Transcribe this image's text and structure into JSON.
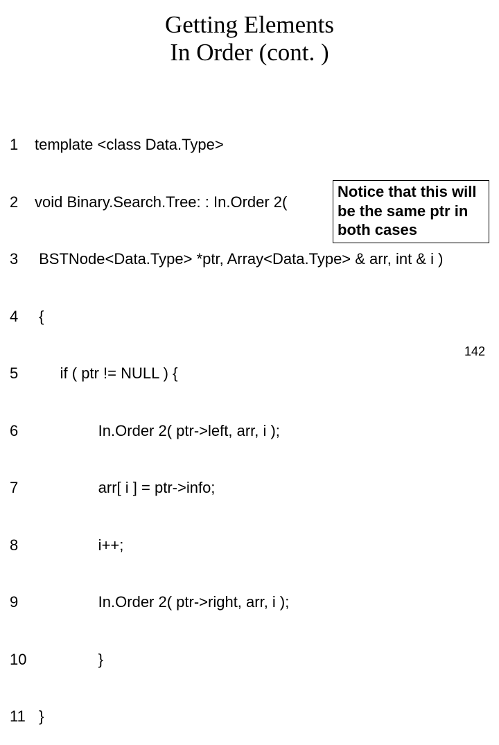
{
  "title_line1": "Getting Elements",
  "title_line2": "In Order (cont. )",
  "code": {
    "lines": [
      {
        "n": "1",
        "t": "template <class Data.Type>"
      },
      {
        "n": "2",
        "t": "void Binary.Search.Tree: : In.Order 2("
      },
      {
        "n": "3",
        "t": " BSTNode<Data.Type> *ptr, Array<Data.Type> & arr, int & i )"
      },
      {
        "n": "4",
        "t": " {"
      },
      {
        "n": "5",
        "t": "      if ( ptr != NULL ) {"
      },
      {
        "n": "6",
        "t": "               In.Order 2( ptr->left, arr, i );"
      },
      {
        "n": "7",
        "t": "               arr[ i ] = ptr->info;"
      },
      {
        "n": "8",
        "t": "               i++;"
      },
      {
        "n": "9",
        "t": "               In.Order 2( ptr->right, arr, i );"
      },
      {
        "n": "10",
        "t": "               }"
      },
      {
        "n": "11",
        "t": " }"
      }
    ]
  },
  "callout": "Notice that this will be the same ptr in both cases",
  "page_number": "142"
}
